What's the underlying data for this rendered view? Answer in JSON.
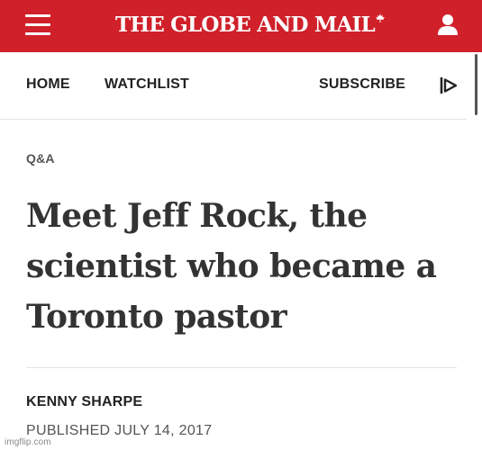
{
  "header": {
    "brand": "THE GLOBE AND MAIL",
    "brand_color": "#d0202a",
    "menu_icon": "hamburger-menu-icon",
    "account_icon": "user-account-icon",
    "brand_mark": "maple-leaf-icon"
  },
  "nav": {
    "items": [
      {
        "label": "HOME"
      },
      {
        "label": "WATCHLIST"
      }
    ],
    "subscribe": "SUBSCRIBE",
    "video_icon": "play-video-icon"
  },
  "article": {
    "kicker": "Q&A",
    "headline": "Meet Jeff Rock, the scientist who became a Toronto pastor",
    "author": "KENNY SHARPE",
    "published": "PUBLISHED JULY 14, 2017"
  },
  "watermark": "imgflip.com"
}
